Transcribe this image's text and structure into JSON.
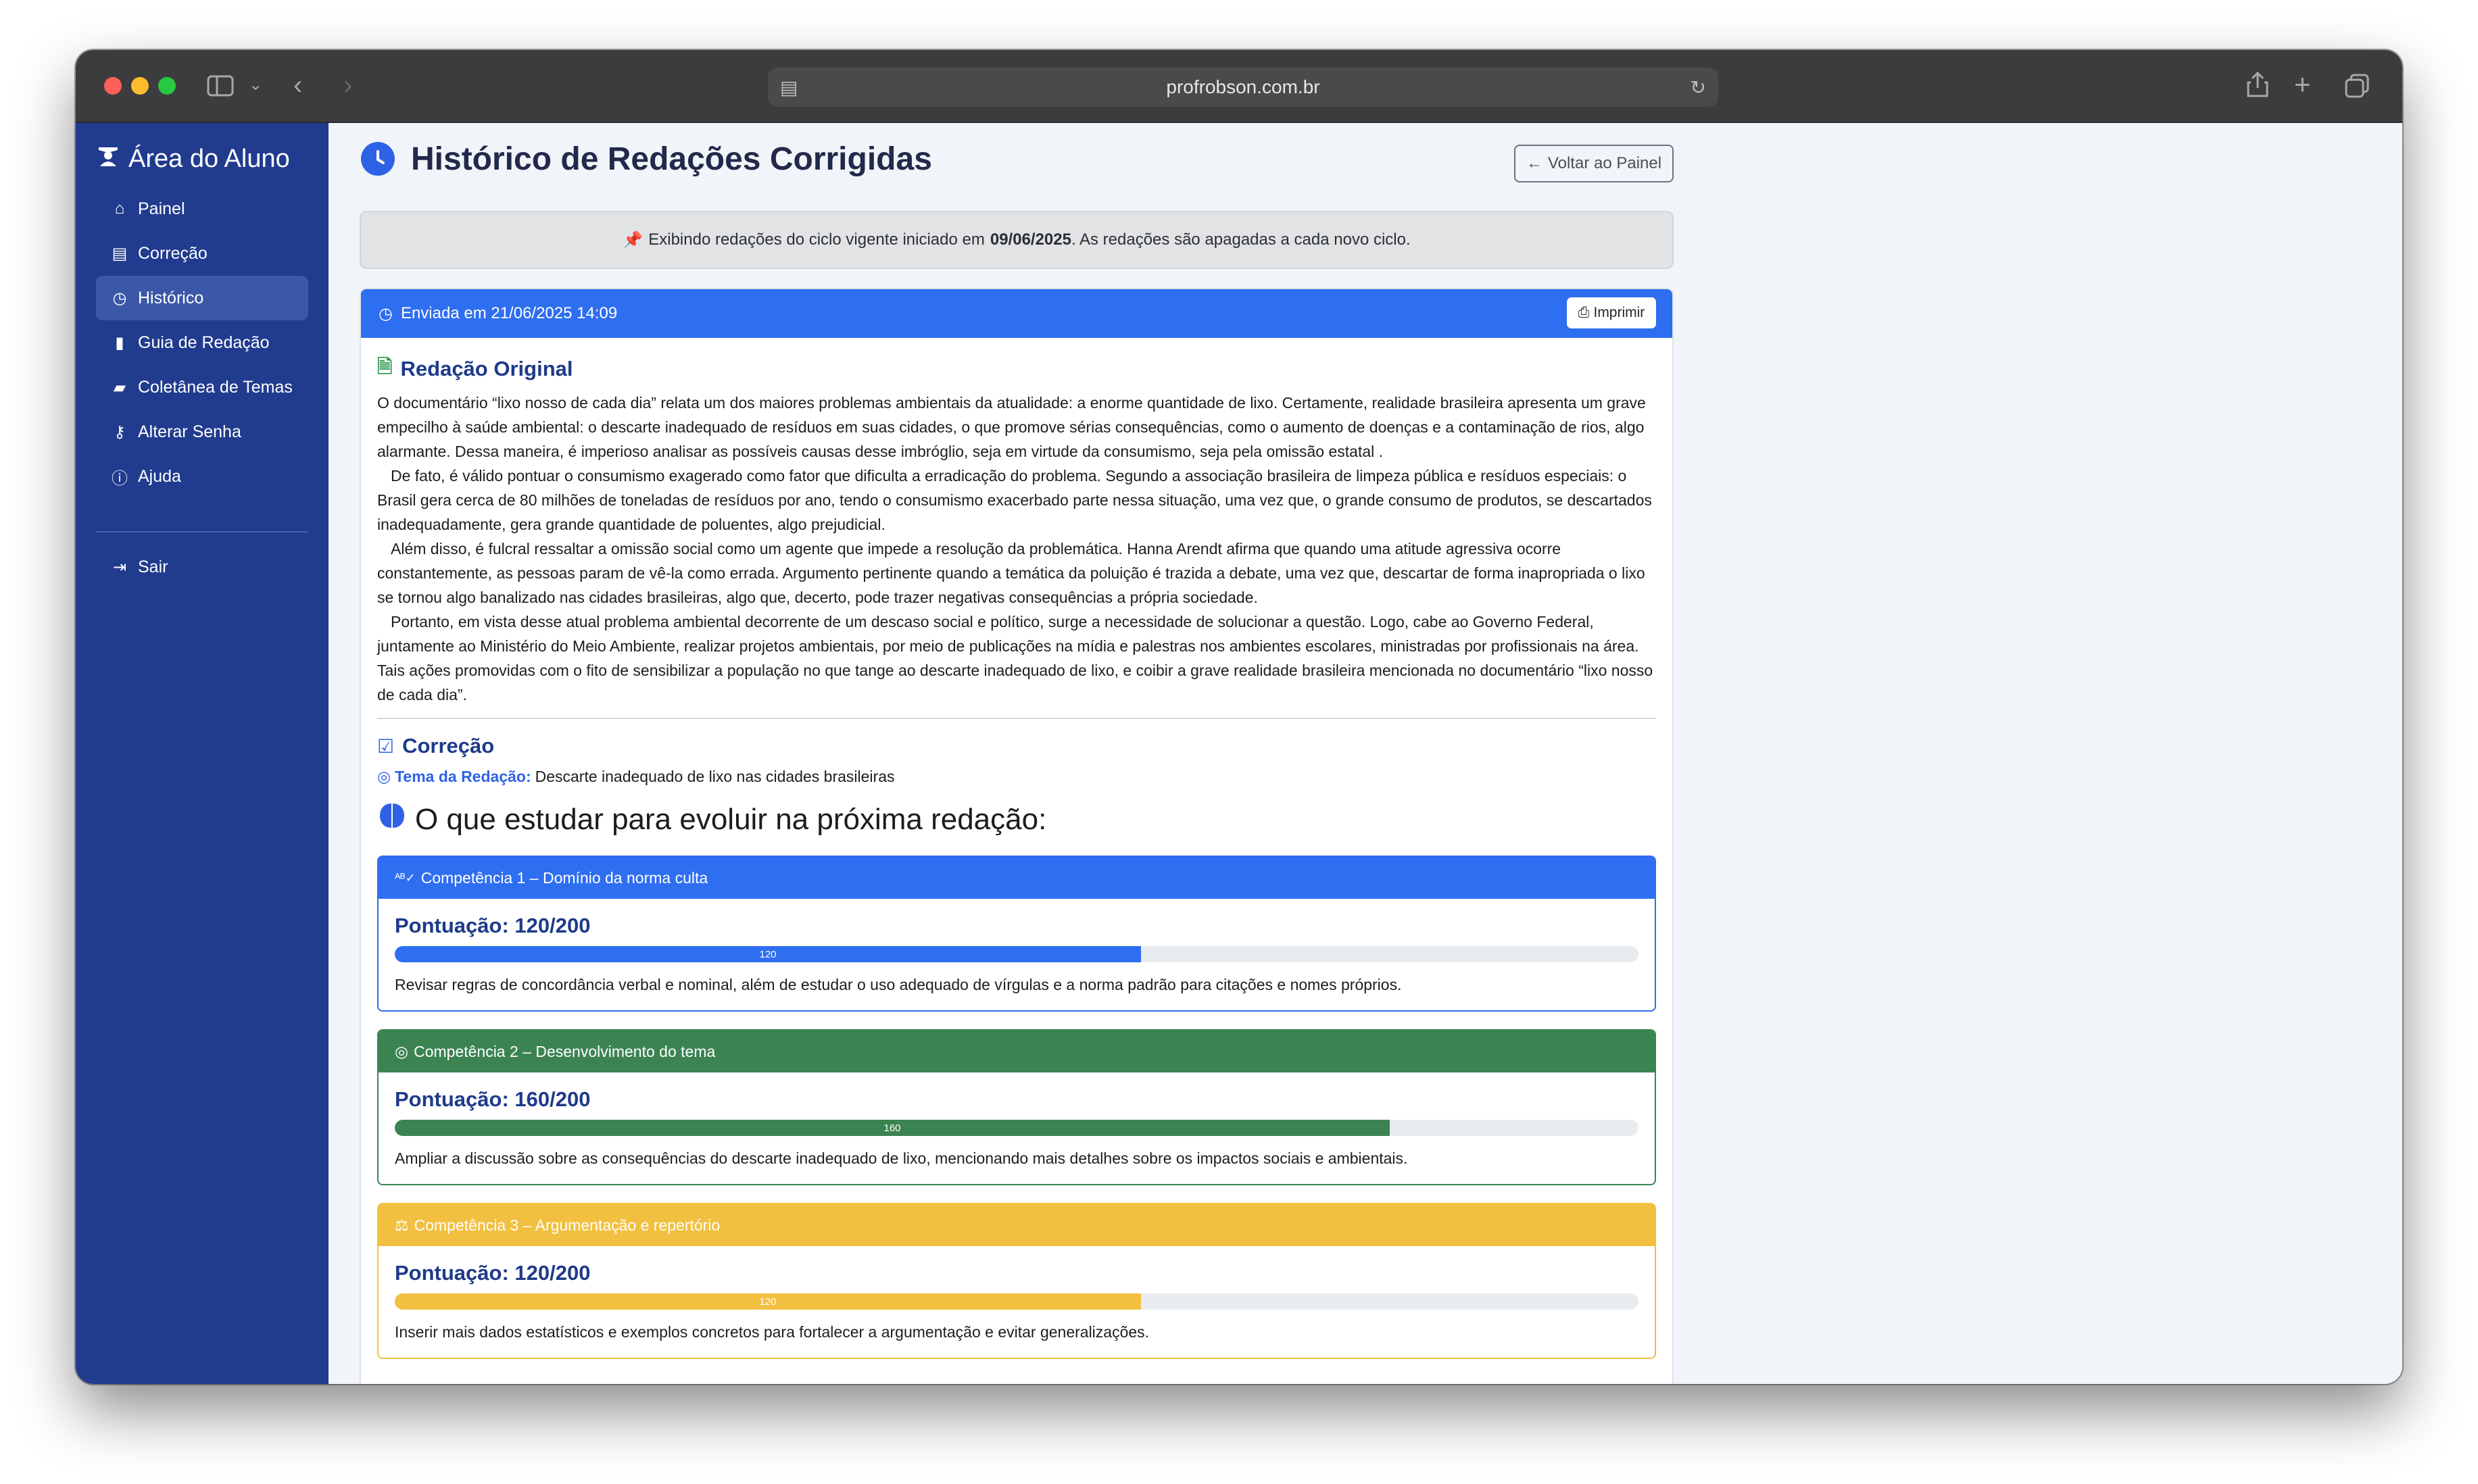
{
  "browser": {
    "url": "profrobson.com.br"
  },
  "sidebar": {
    "brand": "Área do Aluno",
    "items": [
      {
        "label": "Painel",
        "icon": "home-icon"
      },
      {
        "label": "Correção",
        "icon": "document-icon"
      },
      {
        "label": "Histórico",
        "icon": "clock-icon"
      },
      {
        "label": "Guia de Redação",
        "icon": "book-icon"
      },
      {
        "label": "Coletânea de Temas",
        "icon": "folder-icon"
      },
      {
        "label": "Alterar Senha",
        "icon": "key-icon"
      },
      {
        "label": "Ajuda",
        "icon": "info-icon"
      }
    ],
    "logout": "Sair"
  },
  "header": {
    "title": "Histórico de Redações Corrigidas",
    "back_button": "Voltar ao Painel"
  },
  "notice": {
    "prefix": "Exibindo redações do ciclo vigente iniciado em",
    "date": "09/06/2025",
    "suffix": ". As redações são apagadas a cada novo ciclo."
  },
  "submission": {
    "sent_label": "Enviada em 21/06/2025 14:09",
    "print_label": "Imprimir",
    "original_title": "Redação Original",
    "paragraphs": [
      "O documentário “lixo nosso de cada dia” relata um dos maiores problemas ambientais da atualidade: a enorme quantidade de lixo. Certamente, realidade brasileira apresenta um grave empecilho à saúde ambiental: o descarte inadequado de resíduos em suas cidades, o que promove sérias consequências, como o aumento de doenças e a contaminação de rios, algo alarmante. Dessa maneira, é imperioso analisar as possíveis causas desse imbróglio, seja em virtude da consumismo, seja pela omissão estatal .",
      "De fato, é válido pontuar o consumismo exagerado como fator que dificulta a erradicação do problema. Segundo a associação brasileira de limpeza pública e resíduos especiais: o Brasil gera cerca de 80 milhões de toneladas de resíduos por ano, tendo o consumismo exacerbado parte nessa situação, uma vez que, o grande consumo de produtos, se descartados inadequadamente, gera grande quantidade de poluentes, algo prejudicial.",
      "Além disso, é fulcral ressaltar a omissão social como um agente que impede a resolução da problemática. Hanna Arendt afirma que quando uma atitude agressiva ocorre constantemente, as pessoas param de vê-la como errada. Argumento pertinente quando a temática da poluição é trazida a debate, uma vez que, descartar de forma inapropriada o lixo se tornou algo banalizado nas cidades brasileiras, algo que, decerto, pode trazer negativas consequências a própria sociedade.",
      "Portanto, em vista desse atual problema ambiental decorrente de um descaso social e político, surge a necessidade de solucionar a questão. Logo, cabe ao Governo Federal, juntamente ao Ministério do Meio Ambiente, realizar projetos ambientais, por meio de publicações na mídia e palestras nos ambientes escolares, ministradas por profissionais na área. Tais ações promovidas com o fito de sensibilizar a população no que tange ao descarte inadequado de lixo, e coibir a grave realidade brasileira mencionada no documentário “lixo nosso de cada dia”."
    ],
    "correction_title": "Correção",
    "theme_label": "Tema da Redação:",
    "theme_value": "Descarte inadequado de lixo nas cidades brasileiras",
    "study_title": "O que estudar para evoluir na próxima redação:"
  },
  "competencies": [
    {
      "title": "Competência 1 – Domínio da norma culta",
      "icon": "spellcheck-icon",
      "score_label": "Pontuação: 120/200",
      "score": 120,
      "max": 200,
      "bar_label": "120",
      "color": "#2e6ef0",
      "text": "Revisar regras de concordância verbal e nominal, além de estudar o uso adequado de vírgulas e a norma padrão para citações e nomes próprios."
    },
    {
      "title": "Competência 2 – Desenvolvimento do tema",
      "icon": "target-icon",
      "score_label": "Pontuação: 160/200",
      "score": 160,
      "max": 200,
      "bar_label": "160",
      "color": "#3b8452",
      "text": "Ampliar a discussão sobre as consequências do descarte inadequado de lixo, mencionando mais detalhes sobre os impactos sociais e ambientais."
    },
    {
      "title": "Competência 3 – Argumentação e repertório",
      "icon": "scale-icon",
      "score_label": "Pontuação: 120/200",
      "score": 120,
      "max": 200,
      "bar_label": "120",
      "color": "#f2c040",
      "text": "Inserir mais dados estatísticos e exemplos concretos para fortalecer a argumentação e evitar generalizações."
    }
  ]
}
